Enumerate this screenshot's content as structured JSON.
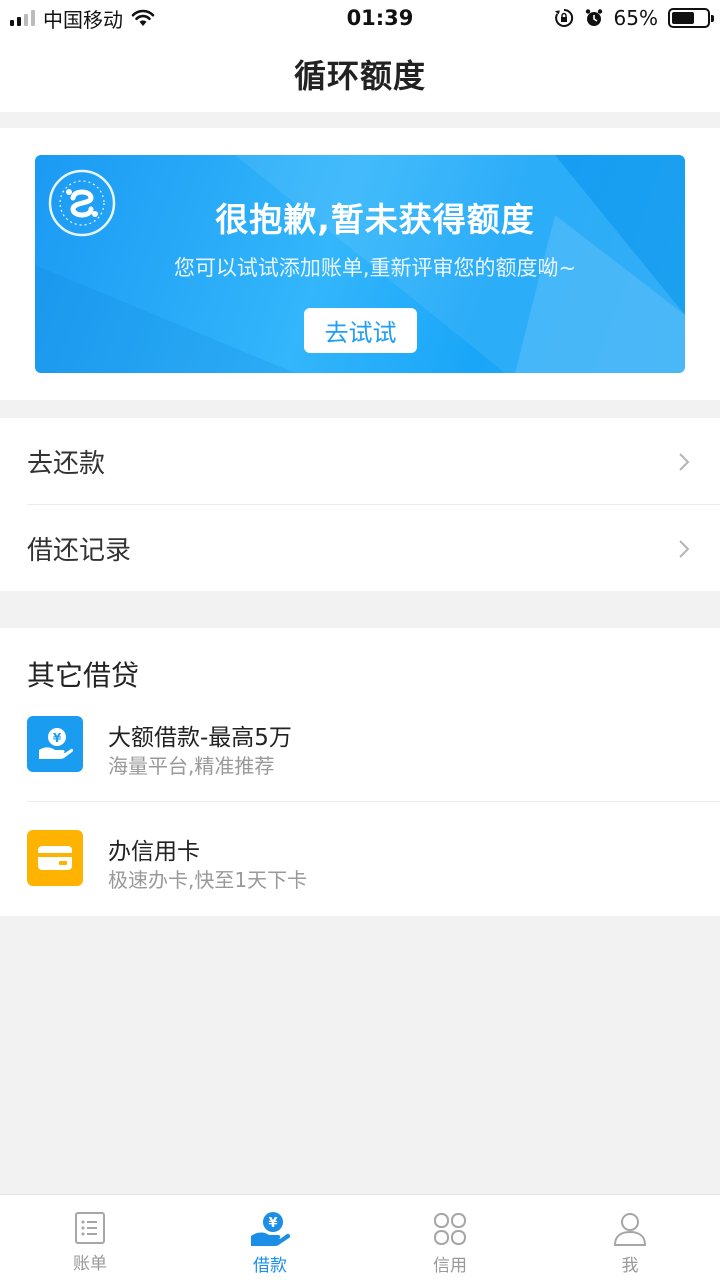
{
  "status_bar": {
    "carrier": "中国移动",
    "time": "01:39",
    "battery_pct": "65%",
    "battery_level": 0.65,
    "icons": [
      "signal-icon",
      "wifi-icon",
      "rotation-lock-icon",
      "alarm-icon",
      "battery-icon"
    ]
  },
  "nav": {
    "title": "循环额度"
  },
  "banner": {
    "title": "很抱歉,暂未获得额度",
    "subtitle": "您可以试试添加账单,重新评审您的额度呦~",
    "button": "去试试",
    "logo_icon": "seal-logo-icon",
    "colors": {
      "start": "#1b9af3",
      "end": "#22a8f6",
      "button_text": "#1e9ef4"
    }
  },
  "menu": {
    "items": [
      {
        "label": "去还款"
      },
      {
        "label": "借还记录"
      }
    ]
  },
  "other_loans": {
    "title": "其它借贷",
    "items": [
      {
        "title": "大额借款-最高5万",
        "subtitle": "海量平台,精准推荐",
        "icon": "hand-yen-icon",
        "color": "#1a9cf0"
      },
      {
        "title": "办信用卡",
        "subtitle": "极速办卡,快至1天下卡",
        "icon": "card-icon",
        "color": "#fdb300"
      }
    ]
  },
  "tabs": [
    {
      "label": "账单",
      "icon": "bill-icon",
      "active": false
    },
    {
      "label": "借款",
      "icon": "loan-icon",
      "active": true
    },
    {
      "label": "信用",
      "icon": "credit-icon",
      "active": false
    },
    {
      "label": "我",
      "icon": "user-icon",
      "active": false
    }
  ],
  "colors": {
    "accent": "#1b8ee8",
    "inactive": "#999999",
    "background": "#f2f2f2"
  }
}
